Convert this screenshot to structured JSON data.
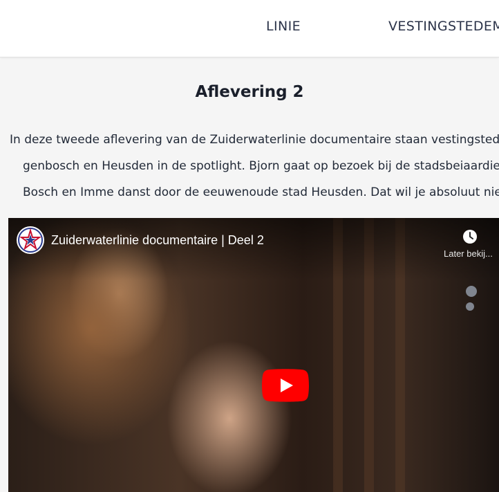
{
  "nav": {
    "items": [
      {
        "label": "LINIE"
      },
      {
        "label": "VESTINGSTEDEM"
      }
    ]
  },
  "article": {
    "title": "Aflevering 2",
    "intro_lines": [
      "In deze tweede aflevering van de Zuiderwaterlinie documentaire staan vestingstede",
      "genbosch en Heusden in de spotlight. Bjorn gaat op bezoek bij de stadsbeiaardier",
      "Bosch en Imme danst door de eeuwenoude stad Heusden. Dat wil je absoluut niet"
    ]
  },
  "video": {
    "title": "Zuiderwaterlinie documentaire | Deel 2",
    "watch_later_label": "Later bekij...",
    "icons": {
      "channel": "channel-logo-icon",
      "watch_later": "clock-icon",
      "play": "youtube-play-icon"
    },
    "colors": {
      "play_button": "#ff0000",
      "logo_red": "#c8102e",
      "logo_blue": "#2a3c8f"
    }
  }
}
